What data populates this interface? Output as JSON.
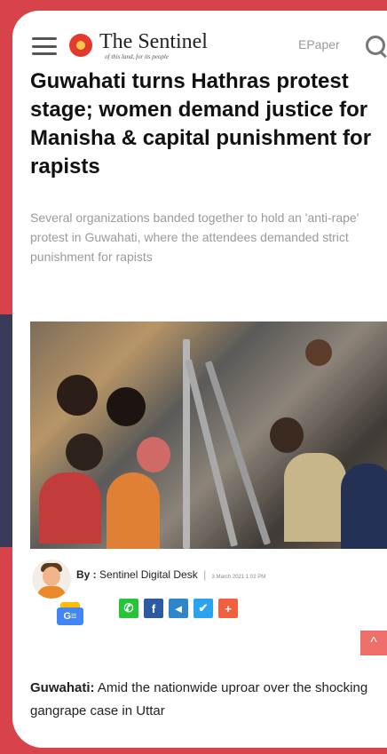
{
  "header": {
    "brand": "The Sentinel",
    "brand_tagline": "of this land, for its people",
    "epaper_label": "EPaper"
  },
  "article": {
    "headline": "Guwahati turns Hathras protest stage; women demand justice for Manisha & capital punishment for rapists",
    "summary": "Several organizations banded together to hold an 'anti-rape' protest in Guwahati, where the attendees demanded strict punishment for rapists",
    "byline_prefix": "By :",
    "author": "Sentinel Digital Desk",
    "separator": "|",
    "date": "3 March 2021 1:02 PM",
    "body_lead": "Guwahati:",
    "body_text": "Amid the nationwide uproar over the shocking gangrape case in Uttar"
  },
  "share": {
    "whatsapp": "✆",
    "facebook": "f",
    "telegram": "◄",
    "twitter": "✔",
    "more": "+"
  },
  "google_news_label": "G≡",
  "back_to_top": "^",
  "colors": {
    "background": "#d8434b",
    "whatsapp": "#27c43a",
    "facebook": "#2d5ba3",
    "telegram": "#2f86c9",
    "twitter": "#2aa3ef",
    "more": "#f1603e"
  }
}
